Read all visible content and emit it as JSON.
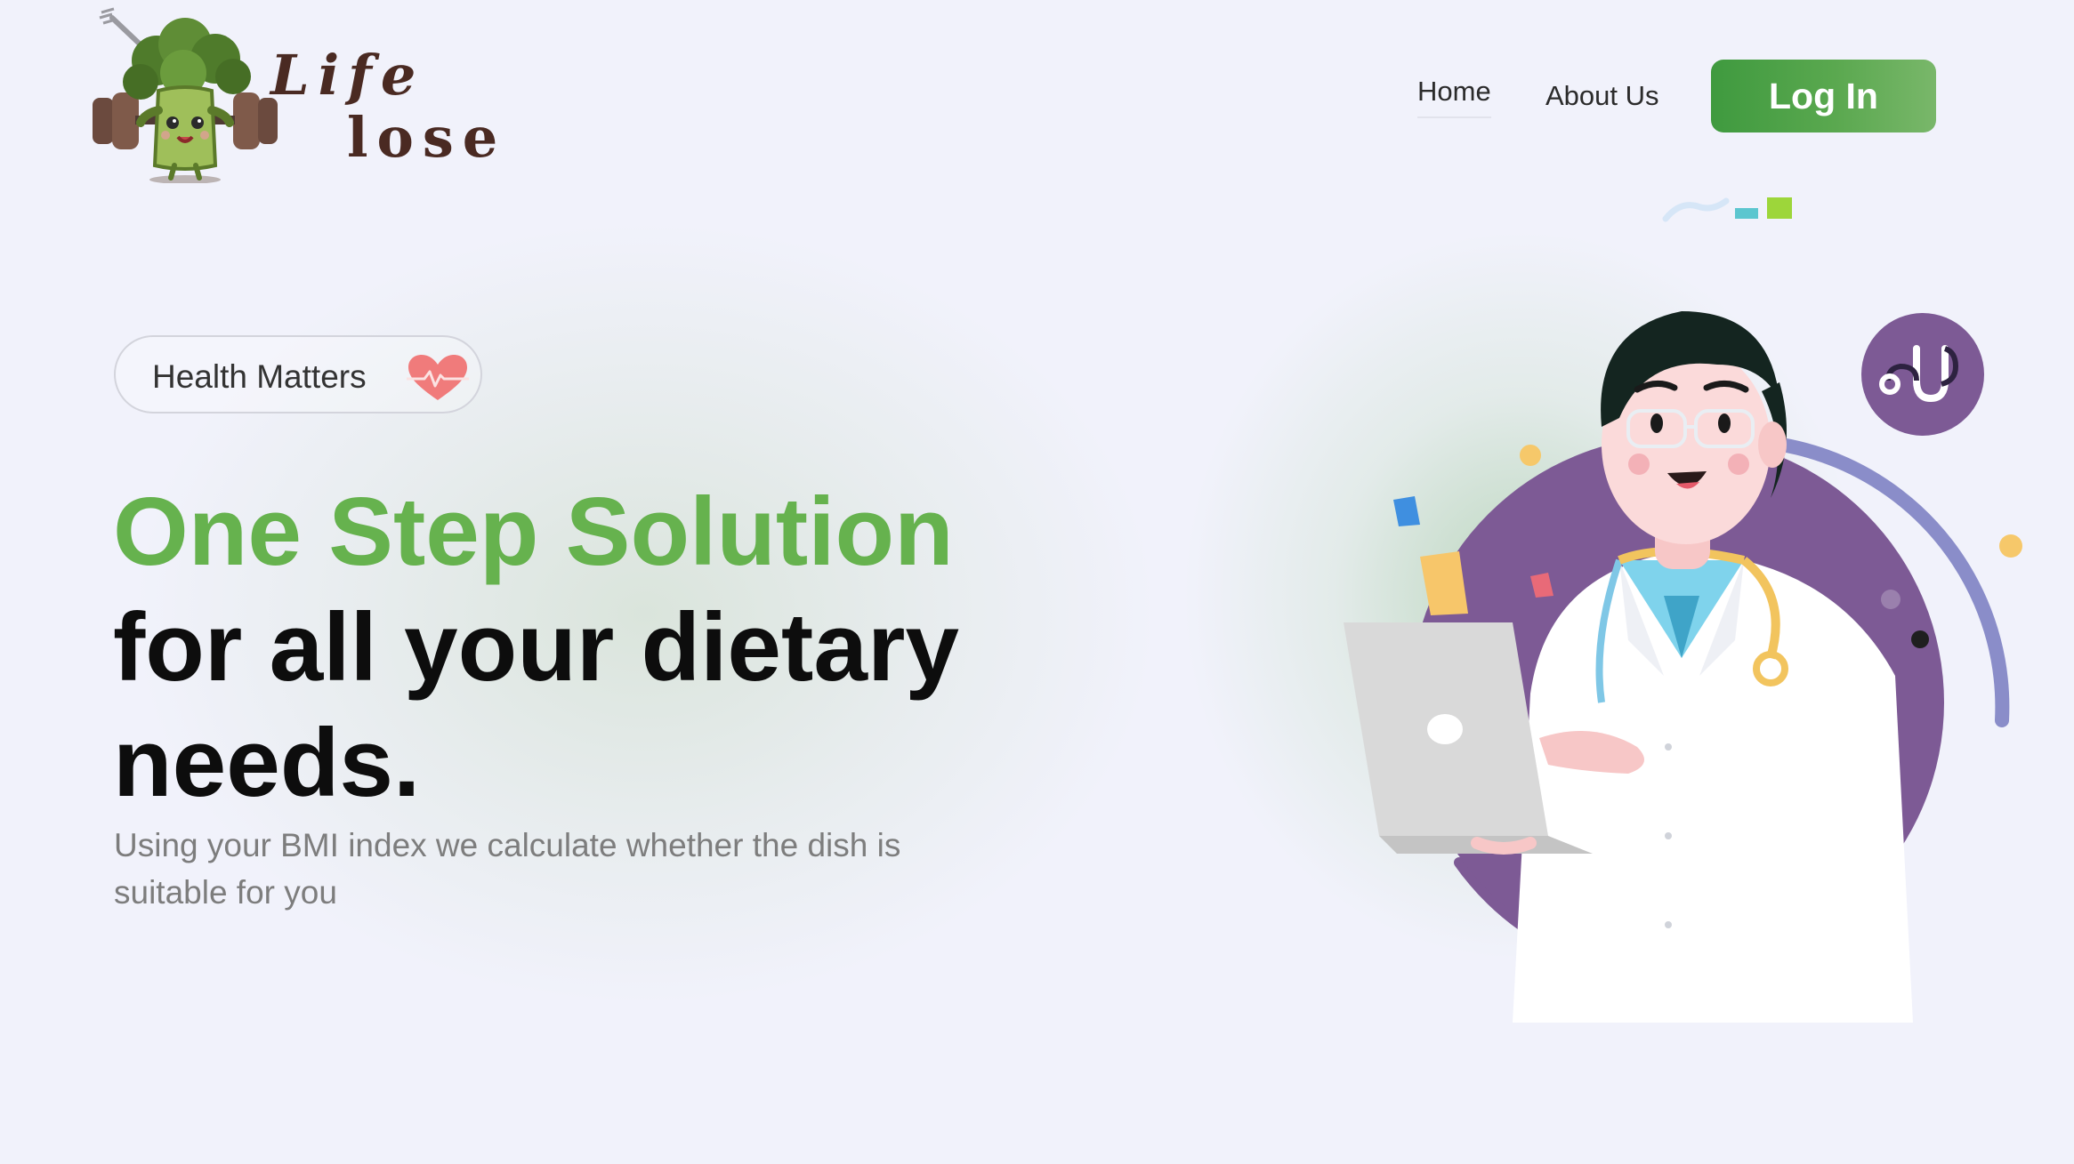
{
  "brand": {
    "line1": "Life",
    "line2": "lose"
  },
  "nav": {
    "home": "Home",
    "about": "About Us",
    "login": "Log In"
  },
  "hero": {
    "badge_label": "Health Matters",
    "badge_icon": "heart-pulse-icon",
    "headline_accent": "One Step Solution",
    "headline_rest": "for all your dietary needs.",
    "description": "Using your BMI index we calculate whether the dish is suitable for you"
  },
  "illustration": {
    "badge_icon": "stethoscope-icon",
    "subject": "doctor-with-laptop"
  },
  "colors": {
    "background": "#f1f2fb",
    "accent_green": "#66b24e",
    "button_green": "#4b9f45",
    "purple": "#7d5a95"
  }
}
